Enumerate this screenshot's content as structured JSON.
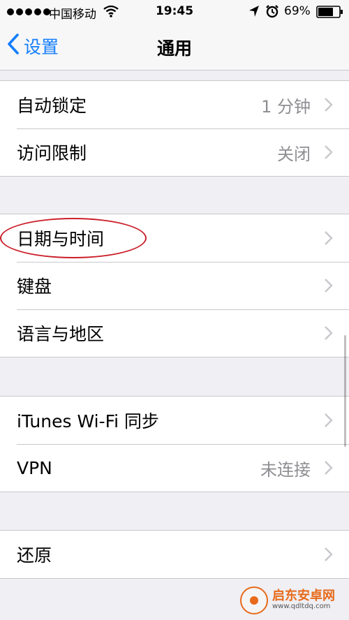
{
  "status_bar": {
    "carrier": "中国移动",
    "time": "19:45",
    "battery": "69%"
  },
  "nav": {
    "back_label": "设置",
    "title": "通用"
  },
  "groups": [
    {
      "rows": [
        {
          "label": "自动锁定",
          "value": "1 分钟"
        },
        {
          "label": "访问限制",
          "value": "关闭"
        }
      ]
    },
    {
      "rows": [
        {
          "label": "日期与时间",
          "value": ""
        },
        {
          "label": "键盘",
          "value": ""
        },
        {
          "label": "语言与地区",
          "value": ""
        }
      ]
    },
    {
      "rows": [
        {
          "label": "iTunes Wi-Fi 同步",
          "value": ""
        },
        {
          "label": "VPN",
          "value": "未连接"
        }
      ]
    },
    {
      "rows": [
        {
          "label": "还原",
          "value": ""
        }
      ]
    }
  ],
  "watermark": {
    "title": "启东安卓网",
    "url": "www.qdltdq.com"
  },
  "colors": {
    "accent": "#147efb",
    "background": "#efeff4",
    "annotation": "#cc1f2a"
  }
}
